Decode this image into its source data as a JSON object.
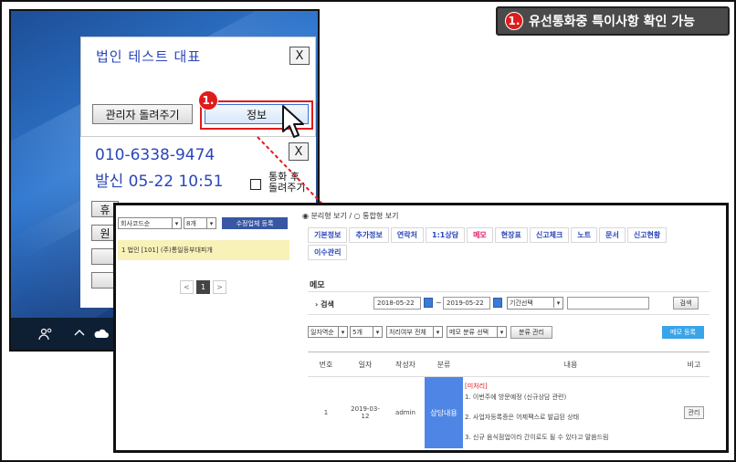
{
  "callout": {
    "number": "1.",
    "text": "유선통화중 특이사항 확인 가능"
  },
  "popup_top": {
    "title": "법인  테스트 대표",
    "close": "X",
    "recall_button": "관리자 돌려주기",
    "info_button": "정보",
    "marker": "1."
  },
  "popup_call": {
    "close": "X",
    "phone": "010-6338-9474",
    "sent": "발신 05-22 10:51",
    "after_call_line1": "통화 후",
    "after_call_line2": "돌려주기",
    "partial_buttons": [
      "휴",
      "원"
    ]
  },
  "taskbar": {
    "icons": [
      "people-icon",
      "chevron-up-icon",
      "cloud-icon"
    ]
  },
  "app": {
    "left": {
      "sort_select": "회사코드순",
      "count_select": "8개",
      "register_button": "수정업체 등록",
      "row_text": "1 법인 [101] (주)통일등부대피개",
      "pager_prev": "<",
      "pager_current": "1",
      "pager_next": ">"
    },
    "right": {
      "view_toggle": "◉ 분리형 보기 / ○ 통합형 보기",
      "tabs": [
        {
          "label": "기본정보",
          "active": false
        },
        {
          "label": "추가정보",
          "active": false
        },
        {
          "label": "연락처",
          "active": false
        },
        {
          "label": "1:1상담",
          "active": false
        },
        {
          "label": "메모",
          "active": true
        },
        {
          "label": "현장표",
          "active": false
        },
        {
          "label": "신고체크",
          "active": false
        },
        {
          "label": "노트",
          "active": false
        },
        {
          "label": "문서",
          "active": false
        },
        {
          "label": "신고현황",
          "active": false
        },
        {
          "label": "이수관리",
          "active": false
        }
      ],
      "section_title": "메모",
      "search_label": "› 검색",
      "date_from": "2018-05-22",
      "date_to": "2019-05-22",
      "period_select": "기간선택",
      "search_button": "검색",
      "filters": {
        "order": "일자역순",
        "count": "5개",
        "processed": "처리여부 전체",
        "category": "메모 분류 선택",
        "category_manage": "분류 관리",
        "add_memo": "메모 등록"
      },
      "columns": [
        "번호",
        "일자",
        "작성자",
        "분류",
        "내용",
        "비고"
      ],
      "rows": [
        {
          "no": "1",
          "date_line1": "2019-03-",
          "date_line2": "12",
          "author": "admin",
          "category": "상담내용",
          "status": "[미처리]",
          "line1": "1. 이번주에 방문예정 (신규상담 관련)",
          "line2": "2. 사업자등록증은 어제팩스로 발급된 상태",
          "line3": "3. 신규 음식점업이라 간이로도 될 수 있다고 말씀드림",
          "action": "관리"
        }
      ]
    }
  }
}
